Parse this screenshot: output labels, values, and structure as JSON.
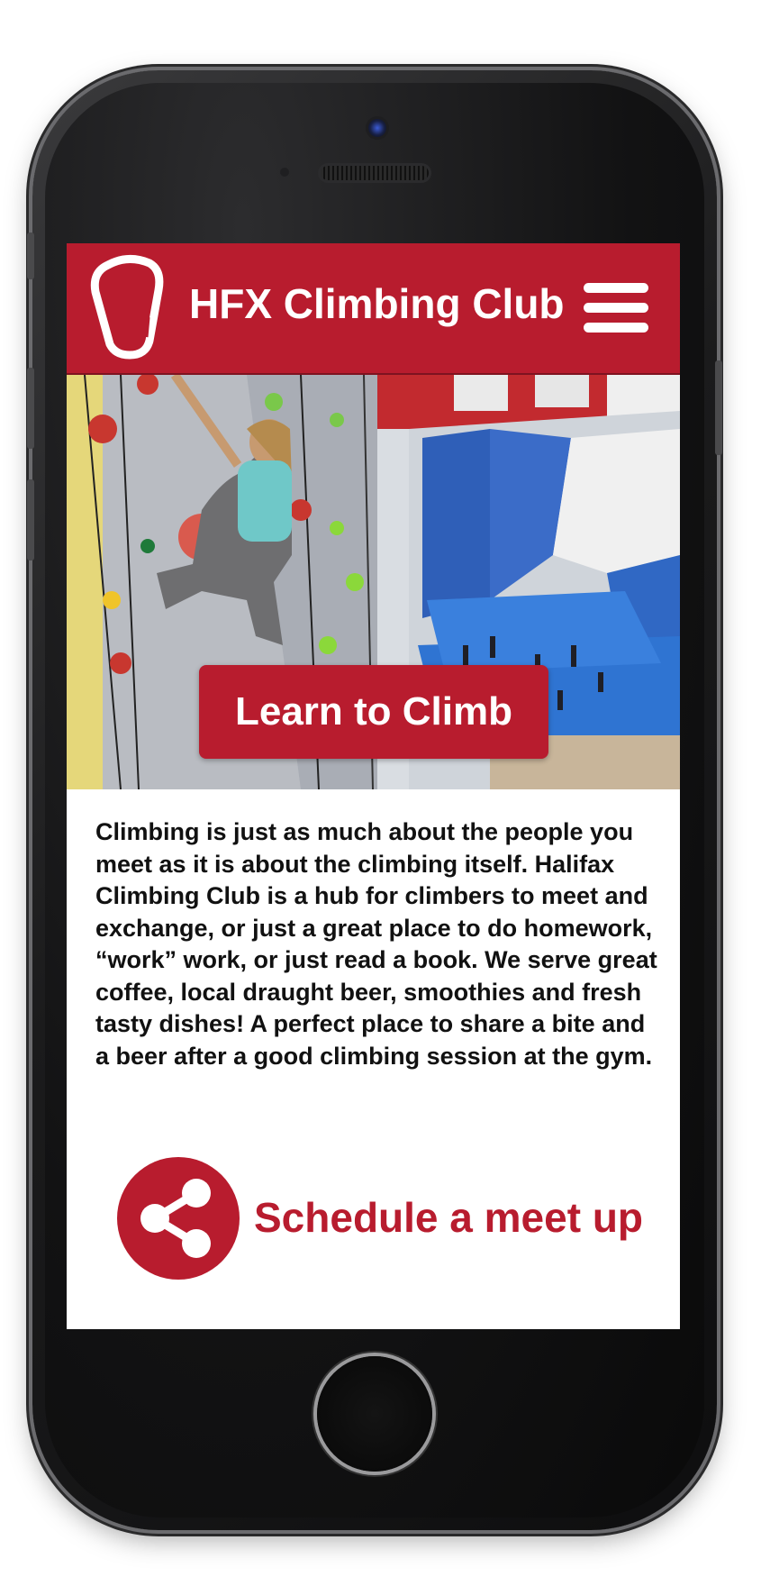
{
  "header": {
    "title": "HFX Climbing Club",
    "logo_icon": "carabiner-icon",
    "menu_icon": "hamburger-menu-icon"
  },
  "hero": {
    "cta_label": "Learn to Climb"
  },
  "intro": {
    "text": "Climbing is just as much about the people you meet as it is about the climbing itself. Halifax Climbing Club is a hub for climbers to meet and exchange, or just a great place to do homework, “work” work, or just read a book. We serve great coffee, local draught beer, smoothies and fresh tasty dishes! A perfect place to share a bite and a beer after a good climbing session at the gym."
  },
  "meetup": {
    "label": "Schedule a meet up",
    "icon": "share-icon"
  },
  "colors": {
    "brand_red": "#b81c2e",
    "text": "#111111",
    "header_text": "#ffffff"
  }
}
